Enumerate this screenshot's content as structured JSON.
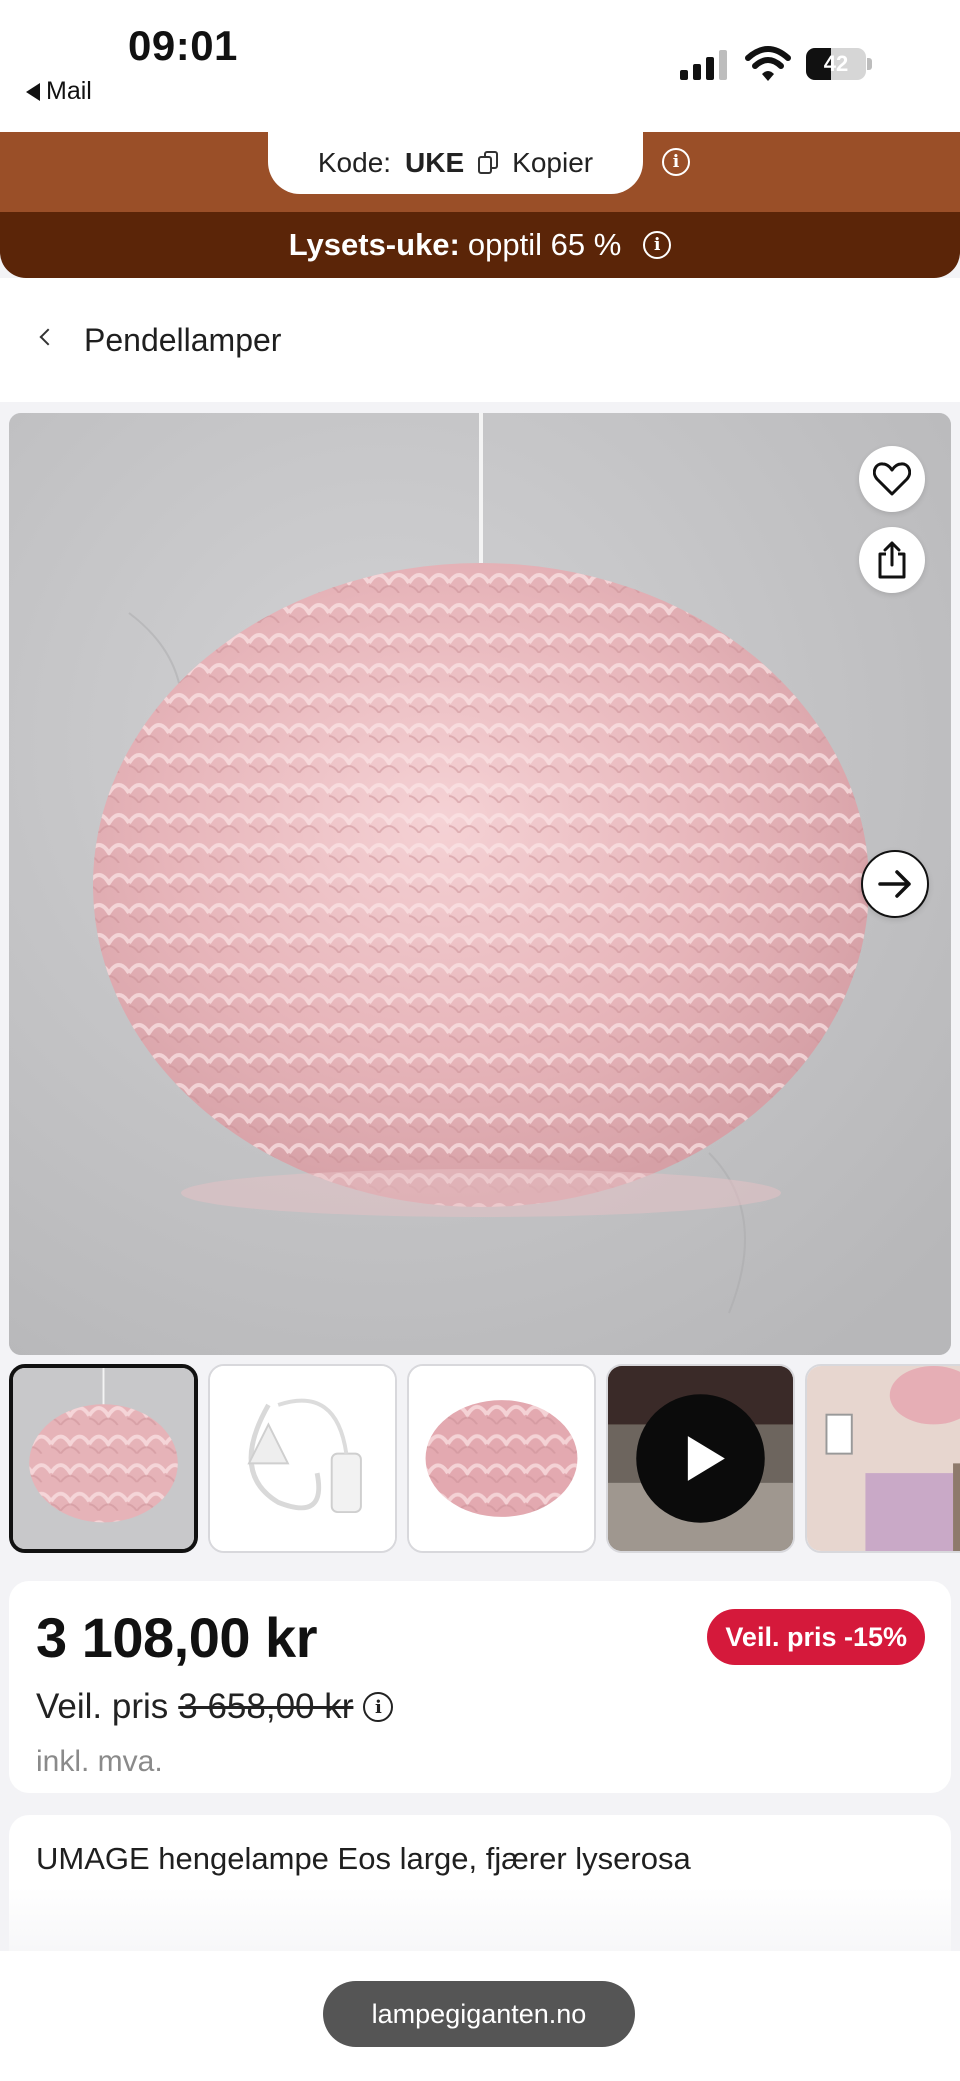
{
  "status_bar": {
    "time": "09:01",
    "back_label": "Mail",
    "battery_level": "42",
    "battery_fraction": 0.42
  },
  "promo": {
    "code_prefix": "Kode:",
    "code": "UKE",
    "copy_label": "Kopier",
    "campaign_lead": "Lysets-uke:",
    "campaign_text": "opptil 65 %",
    "colors": {
      "top": "#9a4f28",
      "bottom": "#5b2508"
    }
  },
  "breadcrumb": {
    "label": "Pendellamper"
  },
  "gallery": {
    "image_count": 5,
    "active_index": 0,
    "thumbnails": [
      {
        "kind": "photo",
        "subject": "pink-feather-lamp"
      },
      {
        "kind": "photo",
        "subject": "white-cord-set"
      },
      {
        "kind": "photo",
        "subject": "pink-feather-shade"
      },
      {
        "kind": "video",
        "subject": "video-demo"
      },
      {
        "kind": "photo",
        "subject": "room-interior"
      }
    ]
  },
  "product": {
    "price": "3 108,00 kr",
    "discount_badge": "Veil. pris -15%",
    "rrp_label": "Veil. pris",
    "rrp_value": "3 658,00 kr",
    "vat_note": "inkl. mva.",
    "title": "UMAGE hengelampe Eos large, fjærer lyserosa"
  },
  "browser": {
    "url": "lampegiganten.no"
  },
  "colors": {
    "badge": "#d5193b",
    "feather_pink": "#e8b8bc",
    "wall_gray": "#c4c4c6"
  },
  "icons": {
    "back": "back-triangle-icon",
    "copy": "copy-icon",
    "info": "info-icon",
    "favorite": "heart-icon",
    "share": "share-icon",
    "next": "arrow-right-icon",
    "play": "play-icon",
    "breadcrumb": "chevron-left-icon"
  }
}
